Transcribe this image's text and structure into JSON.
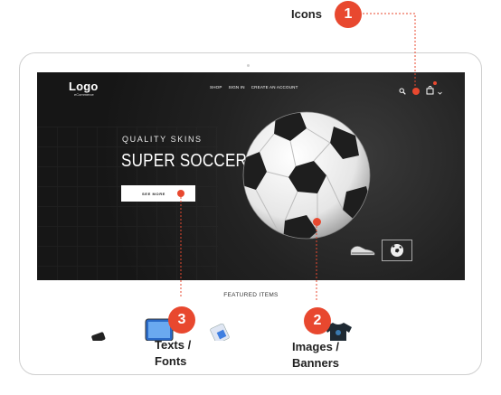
{
  "header": {
    "logo": "Logo",
    "logo_sub": "eCommerce",
    "nav": [
      "SHOP",
      "SIGN IN",
      "CREATE AN ACCOUNT"
    ],
    "cart_badge": ""
  },
  "hero": {
    "tagline": "QUALITY SKINS",
    "title": "SUPER SOCCER",
    "button": "SEE MORE"
  },
  "featured": {
    "heading": "FEATURED ITEMS"
  },
  "callouts": [
    {
      "number": "1",
      "label": "Icons"
    },
    {
      "number": "2",
      "label_line1": "Images /",
      "label_line2": "Banners"
    },
    {
      "number": "3",
      "label_line1": "Texts /",
      "label_line2": "Fonts"
    }
  ],
  "colors": {
    "accent": "#e8482f",
    "hero_bg": "#1c1c1c",
    "text_dark": "#222222"
  },
  "icons": [
    "search-icon",
    "cart-icon",
    "chevron-down-icon",
    "soccer-ball-icon",
    "sneaker-icon",
    "phone-icon",
    "tablet-icon",
    "tshirt-icon"
  ]
}
